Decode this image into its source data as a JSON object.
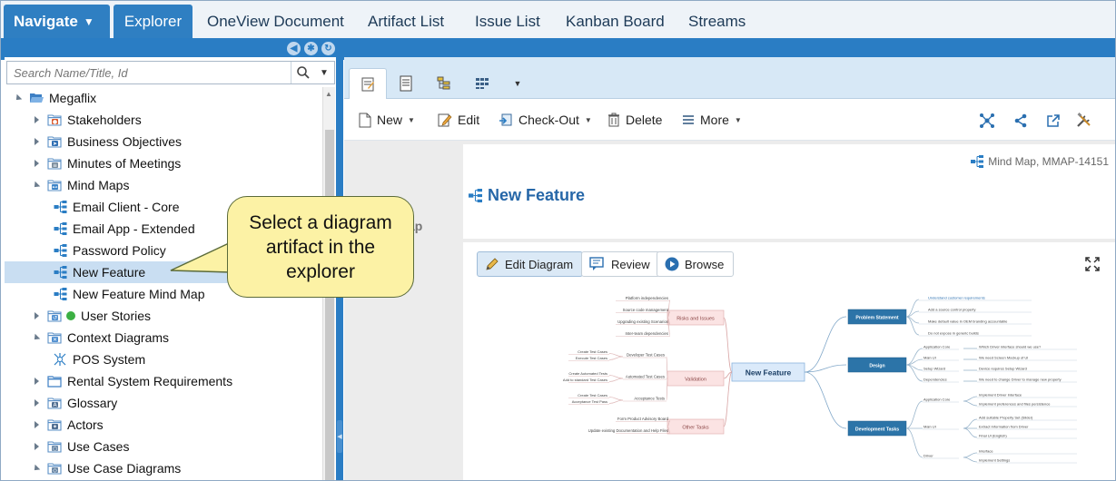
{
  "nav": {
    "navigate_label": "Navigate",
    "tabs": [
      "Explorer",
      "OneView Document",
      "Artifact List",
      "Issue List",
      "Kanban Board",
      "Streams"
    ]
  },
  "search": {
    "placeholder": "Search Name/Title, Id"
  },
  "tree": [
    {
      "label": "Megaflix",
      "level": 0,
      "toggle": "open",
      "icon": "folder-open-icon"
    },
    {
      "label": "Stakeholders",
      "level": 1,
      "toggle": "closed",
      "icon": "stakeholders-icon"
    },
    {
      "label": "Business Objectives",
      "level": 1,
      "toggle": "closed",
      "icon": "objectives-icon"
    },
    {
      "label": "Minutes of Meetings",
      "level": 1,
      "toggle": "closed",
      "icon": "minutes-icon"
    },
    {
      "label": "Mind Maps",
      "level": 1,
      "toggle": "open",
      "icon": "mindmap-folder-icon"
    },
    {
      "label": "Email Client - Core",
      "level": 2,
      "toggle": "none",
      "icon": "mindmap-icon"
    },
    {
      "label": "Email App - Extended",
      "level": 2,
      "toggle": "none",
      "icon": "mindmap-icon"
    },
    {
      "label": "Password Policy",
      "level": 2,
      "toggle": "none",
      "icon": "mindmap-icon"
    },
    {
      "label": "New Feature",
      "level": 2,
      "toggle": "none",
      "icon": "mindmap-icon",
      "selected": true
    },
    {
      "label": "New Feature Mind Map",
      "level": 2,
      "toggle": "none",
      "icon": "mindmap-icon"
    },
    {
      "label": "User Stories",
      "level": 1,
      "toggle": "closed",
      "icon": "user-stories-icon",
      "status_dot": "#3cb043"
    },
    {
      "label": "Context Diagrams",
      "level": 1,
      "toggle": "open",
      "icon": "context-diagram-icon"
    },
    {
      "label": "POS System",
      "level": 2,
      "toggle": "none",
      "icon": "context-node-icon"
    },
    {
      "label": "Rental System Requirements",
      "level": 1,
      "toggle": "closed",
      "icon": "folder-icon"
    },
    {
      "label": "Glossary",
      "level": 1,
      "toggle": "closed",
      "icon": "glossary-icon"
    },
    {
      "label": "Actors",
      "level": 1,
      "toggle": "closed",
      "icon": "actors-icon"
    },
    {
      "label": "Use Cases",
      "level": 1,
      "toggle": "closed",
      "icon": "use-case-icon"
    },
    {
      "label": "Use Case Diagrams",
      "level": 1,
      "toggle": "open",
      "icon": "use-case-diagram-icon"
    }
  ],
  "toolbar": {
    "new_label": "New",
    "edit_label": "Edit",
    "checkout_label": "Check-Out",
    "delete_label": "Delete",
    "more_label": "More"
  },
  "artifact": {
    "meta": "Mind Map, MMAP-14151",
    "title": "New Feature",
    "ghost_text": "ap"
  },
  "diagram": {
    "edit_label": "Edit Diagram",
    "review_label": "Review",
    "browse_label": "Browse"
  },
  "callout": {
    "text": "Select a diagram artifact in the explorer"
  },
  "mindmap": {
    "center": "New Feature",
    "left_branches": [
      {
        "label": "Risks and Issues",
        "leaves": [
          "Platform independencies",
          "Source code management",
          "Upgrading existing Scenarios",
          "Inter-team dependencies"
        ]
      },
      {
        "label": "Validation",
        "subs": [
          {
            "label": "Developer Test Cases",
            "leaves": [
              "Create Test Cases",
              "Execute Test Cases"
            ]
          },
          {
            "label": "Automated Test Cases",
            "leaves": [
              "Create Automated Tests",
              "Add to standard Test Cases"
            ]
          },
          {
            "label": "Acceptance Tests",
            "leaves": [
              "Create Test Cases",
              "Acceptance Test Pass"
            ]
          }
        ]
      },
      {
        "label": "Other Tasks",
        "leaves": [
          "Form Product Advisory Board",
          "Update existing Documentation and Help Files"
        ]
      }
    ],
    "right_branches": [
      {
        "label": "Problem Statement",
        "leaves": [
          "Understand customer requirements",
          "Add a source control property",
          "Make default value in OEM branding accountable",
          "Do not expose in generic builds"
        ]
      },
      {
        "label": "Design",
        "subs": [
          {
            "label": "Application Core",
            "leaves": [
              "Which Driver interface should we use?"
            ]
          },
          {
            "label": "Main UI",
            "leaves": [
              "We need Screen Mockup of UI"
            ]
          },
          {
            "label": "Setup Wizard",
            "leaves": [
              "Device requires Setup Wizard"
            ]
          },
          {
            "label": "Dependencies",
            "leaves": [
              "We need to change Driver to manage new property"
            ]
          }
        ]
      },
      {
        "label": "Development Tasks",
        "subs": [
          {
            "label": "Application Core",
            "leaves": [
              "Implement Driver Interface",
              "Implement preferences and files persistence"
            ]
          },
          {
            "label": "Main UI",
            "leaves": [
              "Add suitable Property Set (Slider)",
              "Extract Information from Driver",
              "Final UI (English)"
            ]
          },
          {
            "label": "Driver",
            "leaves": [
              "Interface",
              "Implement Settings"
            ]
          }
        ]
      }
    ]
  },
  "colors": {
    "accent": "#2f7fc2",
    "band": "#2a7dc4",
    "selected_row": "#c9def2",
    "callout_bg": "#fcf2a5",
    "mm_center": "#dbeafa",
    "mm_left_branch": "#fbe3e3",
    "mm_right_branch": "#2c74a8"
  }
}
